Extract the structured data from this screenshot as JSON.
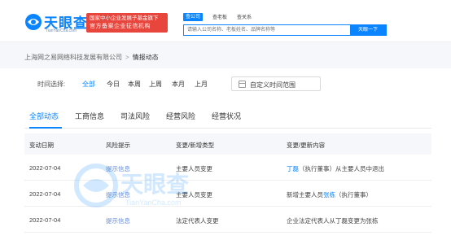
{
  "header": {
    "logo_text": "天眼查",
    "logo_url": "TianYanCha.com",
    "badge_line1": "国家中小企业发展子基金旗下",
    "badge_line2": "官方备案企业征信机构",
    "search_tabs": [
      "查公司",
      "查老板",
      "查关系"
    ],
    "search_placeholder": "请输入公司名称、老板姓名、品牌名称等",
    "search_button": "天眼一下"
  },
  "breadcrumb": {
    "company": "上海网之易网络科技发展有限公司",
    "separator": ">",
    "current": "情报动态"
  },
  "filter": {
    "label": "时间选择:",
    "options": [
      "全部",
      "今日",
      "本周",
      "上周",
      "本月",
      "上月"
    ],
    "active": "全部",
    "custom_label": "自定义时间范围"
  },
  "tabs": [
    "全部动态",
    "工商信息",
    "司法风险",
    "经营风险",
    "经营状况"
  ],
  "active_tab": "全部动态",
  "table": {
    "headers": [
      "变动日期",
      "风险提示",
      "变更/新增类型",
      "变更/更新内容"
    ],
    "rows": [
      {
        "date": "2022-07-04",
        "risk": "提示信息",
        "type": "主要人员变更",
        "content_pre": "",
        "content_hl": "丁磊",
        "content_post": "（执行董事）从主要人员中退出"
      },
      {
        "date": "2022-07-04",
        "risk": "提示信息",
        "type": "主要人员变更",
        "content_pre": "新增主要人员",
        "content_hl": "张栋",
        "content_post": "（执行董事）"
      },
      {
        "date": "2022-07-04",
        "risk": "提示信息",
        "type": "法定代表人变更",
        "content_pre": "企业法定代表人从丁磊变更为张栋",
        "content_hl": "",
        "content_post": ""
      }
    ]
  },
  "watermark": {
    "text": "天眼查",
    "url": "TianYanCha.com"
  },
  "colors": {
    "brand_blue": "#0a84ff",
    "badge_red": "#e8463c",
    "tip_blue": "#6a8fd8"
  }
}
